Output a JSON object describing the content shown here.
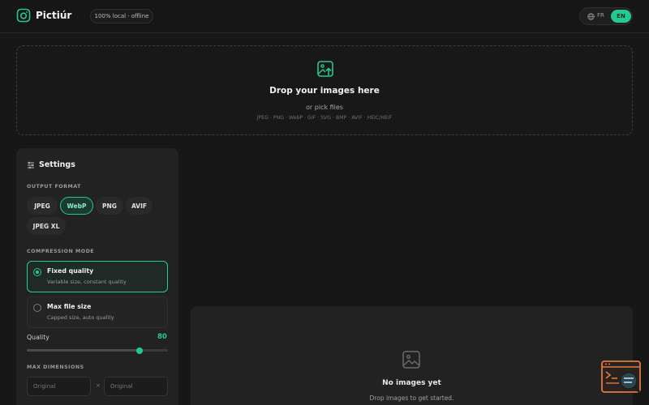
{
  "header": {
    "app_name": "Pictiúr",
    "badge": "100% local · offline",
    "lang_fr": "FR",
    "lang_en": "EN"
  },
  "dropzone": {
    "title": "Drop your images here",
    "subtitle": "or pick files",
    "formats": "JPEG · PNG · WebP · GIF · SVG · BMP · AVIF · HEIC/HEIF"
  },
  "settings": {
    "title": "Settings",
    "output_format_label": "OUTPUT FORMAT",
    "formats": [
      "JPEG",
      "WebP",
      "PNG",
      "AVIF",
      "JPEG XL"
    ],
    "selected_format": "WebP",
    "compression_label": "COMPRESSION MODE",
    "modes": [
      {
        "title": "Fixed quality",
        "subtitle": "Variable size, constant quality",
        "selected": true
      },
      {
        "title": "Max file size",
        "subtitle": "Capped size, auto quality",
        "selected": false
      }
    ],
    "quality_label": "Quality",
    "quality_value": "80",
    "quality_fraction": 0.8,
    "max_dimensions_label": "MAX DIMENSIONS",
    "width_placeholder": "Original",
    "height_placeholder": "Original",
    "dim_separator": "×"
  },
  "empty_state": {
    "title": "No images yet",
    "subtitle": "Drop images to get started."
  },
  "colors": {
    "accent": "#22c993",
    "background": "#171717",
    "panel": "#222222"
  }
}
